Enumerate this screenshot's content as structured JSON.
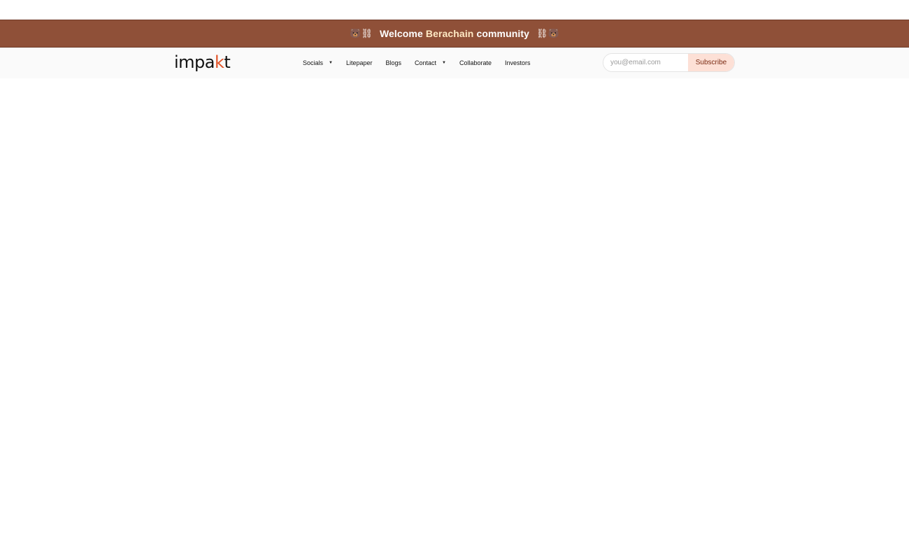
{
  "announcement": {
    "emoji_left": "🐻⛓",
    "welcome": "Welcome",
    "highlight": "Berachain",
    "community": "community",
    "emoji_right": "⛓🐻",
    "colors": {
      "background": "#8f5038",
      "highlight": "#ffe9c4"
    }
  },
  "header": {
    "logo": {
      "prefix": "impa",
      "accent": "k",
      "suffix": "t",
      "accent_color": "#e2552a"
    },
    "menu": [
      {
        "label": "Socials",
        "has_dropdown": true
      },
      {
        "label": "Litepaper",
        "has_dropdown": false
      },
      {
        "label": "Blogs",
        "has_dropdown": false
      },
      {
        "label": "Contact",
        "has_dropdown": true
      },
      {
        "label": "Collaborate",
        "has_dropdown": false
      },
      {
        "label": "Investors",
        "has_dropdown": false
      }
    ],
    "subscribe": {
      "placeholder": "you@email.com",
      "value": "",
      "button_label": "Subscribe",
      "button_color": "#fde0d6"
    }
  }
}
